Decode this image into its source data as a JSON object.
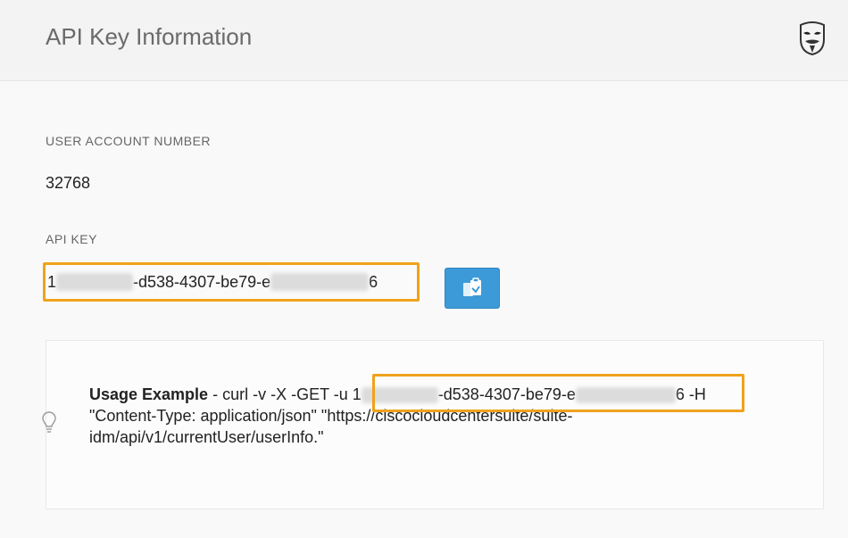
{
  "header": {
    "title": "API Key Information",
    "avatar_icon": "anonymous-mask-icon"
  },
  "account": {
    "label": "USER ACCOUNT NUMBER",
    "value": "32768"
  },
  "api_key": {
    "label": "API KEY",
    "prefix": "1",
    "middle": "-d538-4307-be79-e",
    "suffix": "6",
    "copy_icon": "copy-to-clipboard-icon"
  },
  "usage": {
    "bold_label": "Usage Example",
    "command_start": " - curl -v -X -GET -u ",
    "key_prefix": "1",
    "key_middle": "-d538-4307-be79-e",
    "key_suffix": "6",
    "command_end": " -H \"Content-Type: application/json\" \"https://ciscocloudcentersuite/suite-idm/api/v1/currentUser/userInfo.\"",
    "icon": "lightbulb-icon"
  },
  "colors": {
    "highlight_border": "#f0a21c",
    "copy_button_bg": "#3d9ad8"
  }
}
